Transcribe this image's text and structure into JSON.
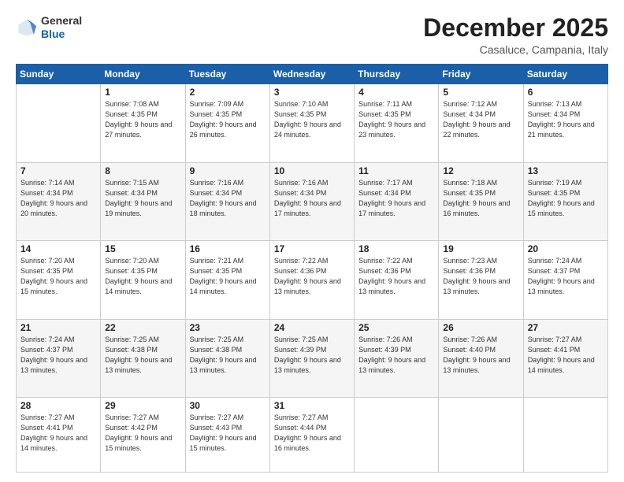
{
  "header": {
    "logo_general": "General",
    "logo_blue": "Blue",
    "month_title": "December 2025",
    "location": "Casaluce, Campania, Italy"
  },
  "days_of_week": [
    "Sunday",
    "Monday",
    "Tuesday",
    "Wednesday",
    "Thursday",
    "Friday",
    "Saturday"
  ],
  "weeks": [
    [
      {
        "num": "",
        "sunrise": "",
        "sunset": "",
        "daylight": ""
      },
      {
        "num": "1",
        "sunrise": "Sunrise: 7:08 AM",
        "sunset": "Sunset: 4:35 PM",
        "daylight": "Daylight: 9 hours and 27 minutes."
      },
      {
        "num": "2",
        "sunrise": "Sunrise: 7:09 AM",
        "sunset": "Sunset: 4:35 PM",
        "daylight": "Daylight: 9 hours and 26 minutes."
      },
      {
        "num": "3",
        "sunrise": "Sunrise: 7:10 AM",
        "sunset": "Sunset: 4:35 PM",
        "daylight": "Daylight: 9 hours and 24 minutes."
      },
      {
        "num": "4",
        "sunrise": "Sunrise: 7:11 AM",
        "sunset": "Sunset: 4:35 PM",
        "daylight": "Daylight: 9 hours and 23 minutes."
      },
      {
        "num": "5",
        "sunrise": "Sunrise: 7:12 AM",
        "sunset": "Sunset: 4:34 PM",
        "daylight": "Daylight: 9 hours and 22 minutes."
      },
      {
        "num": "6",
        "sunrise": "Sunrise: 7:13 AM",
        "sunset": "Sunset: 4:34 PM",
        "daylight": "Daylight: 9 hours and 21 minutes."
      }
    ],
    [
      {
        "num": "7",
        "sunrise": "Sunrise: 7:14 AM",
        "sunset": "Sunset: 4:34 PM",
        "daylight": "Daylight: 9 hours and 20 minutes."
      },
      {
        "num": "8",
        "sunrise": "Sunrise: 7:15 AM",
        "sunset": "Sunset: 4:34 PM",
        "daylight": "Daylight: 9 hours and 19 minutes."
      },
      {
        "num": "9",
        "sunrise": "Sunrise: 7:16 AM",
        "sunset": "Sunset: 4:34 PM",
        "daylight": "Daylight: 9 hours and 18 minutes."
      },
      {
        "num": "10",
        "sunrise": "Sunrise: 7:16 AM",
        "sunset": "Sunset: 4:34 PM",
        "daylight": "Daylight: 9 hours and 17 minutes."
      },
      {
        "num": "11",
        "sunrise": "Sunrise: 7:17 AM",
        "sunset": "Sunset: 4:34 PM",
        "daylight": "Daylight: 9 hours and 17 minutes."
      },
      {
        "num": "12",
        "sunrise": "Sunrise: 7:18 AM",
        "sunset": "Sunset: 4:35 PM",
        "daylight": "Daylight: 9 hours and 16 minutes."
      },
      {
        "num": "13",
        "sunrise": "Sunrise: 7:19 AM",
        "sunset": "Sunset: 4:35 PM",
        "daylight": "Daylight: 9 hours and 15 minutes."
      }
    ],
    [
      {
        "num": "14",
        "sunrise": "Sunrise: 7:20 AM",
        "sunset": "Sunset: 4:35 PM",
        "daylight": "Daylight: 9 hours and 15 minutes."
      },
      {
        "num": "15",
        "sunrise": "Sunrise: 7:20 AM",
        "sunset": "Sunset: 4:35 PM",
        "daylight": "Daylight: 9 hours and 14 minutes."
      },
      {
        "num": "16",
        "sunrise": "Sunrise: 7:21 AM",
        "sunset": "Sunset: 4:35 PM",
        "daylight": "Daylight: 9 hours and 14 minutes."
      },
      {
        "num": "17",
        "sunrise": "Sunrise: 7:22 AM",
        "sunset": "Sunset: 4:36 PM",
        "daylight": "Daylight: 9 hours and 13 minutes."
      },
      {
        "num": "18",
        "sunrise": "Sunrise: 7:22 AM",
        "sunset": "Sunset: 4:36 PM",
        "daylight": "Daylight: 9 hours and 13 minutes."
      },
      {
        "num": "19",
        "sunrise": "Sunrise: 7:23 AM",
        "sunset": "Sunset: 4:36 PM",
        "daylight": "Daylight: 9 hours and 13 minutes."
      },
      {
        "num": "20",
        "sunrise": "Sunrise: 7:24 AM",
        "sunset": "Sunset: 4:37 PM",
        "daylight": "Daylight: 9 hours and 13 minutes."
      }
    ],
    [
      {
        "num": "21",
        "sunrise": "Sunrise: 7:24 AM",
        "sunset": "Sunset: 4:37 PM",
        "daylight": "Daylight: 9 hours and 13 minutes."
      },
      {
        "num": "22",
        "sunrise": "Sunrise: 7:25 AM",
        "sunset": "Sunset: 4:38 PM",
        "daylight": "Daylight: 9 hours and 13 minutes."
      },
      {
        "num": "23",
        "sunrise": "Sunrise: 7:25 AM",
        "sunset": "Sunset: 4:38 PM",
        "daylight": "Daylight: 9 hours and 13 minutes."
      },
      {
        "num": "24",
        "sunrise": "Sunrise: 7:25 AM",
        "sunset": "Sunset: 4:39 PM",
        "daylight": "Daylight: 9 hours and 13 minutes."
      },
      {
        "num": "25",
        "sunrise": "Sunrise: 7:26 AM",
        "sunset": "Sunset: 4:39 PM",
        "daylight": "Daylight: 9 hours and 13 minutes."
      },
      {
        "num": "26",
        "sunrise": "Sunrise: 7:26 AM",
        "sunset": "Sunset: 4:40 PM",
        "daylight": "Daylight: 9 hours and 13 minutes."
      },
      {
        "num": "27",
        "sunrise": "Sunrise: 7:27 AM",
        "sunset": "Sunset: 4:41 PM",
        "daylight": "Daylight: 9 hours and 14 minutes."
      }
    ],
    [
      {
        "num": "28",
        "sunrise": "Sunrise: 7:27 AM",
        "sunset": "Sunset: 4:41 PM",
        "daylight": "Daylight: 9 hours and 14 minutes."
      },
      {
        "num": "29",
        "sunrise": "Sunrise: 7:27 AM",
        "sunset": "Sunset: 4:42 PM",
        "daylight": "Daylight: 9 hours and 15 minutes."
      },
      {
        "num": "30",
        "sunrise": "Sunrise: 7:27 AM",
        "sunset": "Sunset: 4:43 PM",
        "daylight": "Daylight: 9 hours and 15 minutes."
      },
      {
        "num": "31",
        "sunrise": "Sunrise: 7:27 AM",
        "sunset": "Sunset: 4:44 PM",
        "daylight": "Daylight: 9 hours and 16 minutes."
      },
      {
        "num": "",
        "sunrise": "",
        "sunset": "",
        "daylight": ""
      },
      {
        "num": "",
        "sunrise": "",
        "sunset": "",
        "daylight": ""
      },
      {
        "num": "",
        "sunrise": "",
        "sunset": "",
        "daylight": ""
      }
    ]
  ]
}
